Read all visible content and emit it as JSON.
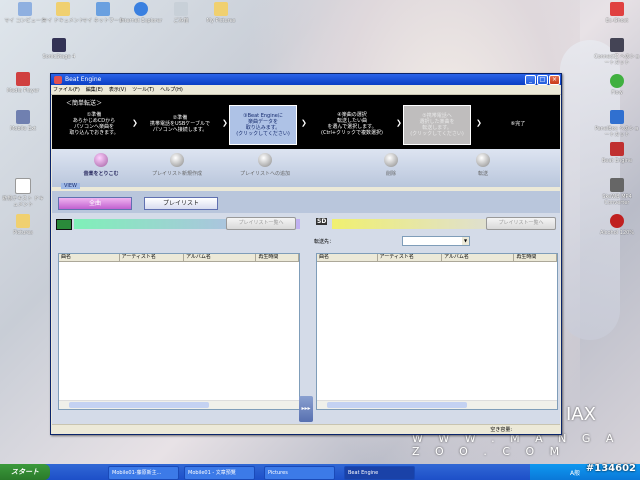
{
  "desktop": {
    "icons_left": [
      {
        "label": "マイ コンピュータ"
      },
      {
        "label": "マイ ドキュメント"
      },
      {
        "label": "マイ ネットワーク"
      },
      {
        "label": "Internet Explorer"
      },
      {
        "label": "ごみ箱"
      },
      {
        "label": "My Pictures"
      }
    ],
    "icons_side_left": [
      {
        "label": "SonicStage 4"
      },
      {
        "label": "Media Player"
      },
      {
        "label": "Mobile Ext"
      },
      {
        "label": "新規テキスト ドキュメント"
      },
      {
        "label": "Pictures"
      }
    ],
    "icons_right": [
      {
        "label": "Ec-Ghost"
      },
      {
        "label": "ConnectZ へのショートカット"
      },
      {
        "label": "Flow"
      },
      {
        "label": "PanelBox へのショートカット"
      },
      {
        "label": "Beat Engine"
      },
      {
        "label": "SkeWB MP4 Converter"
      },
      {
        "label": "Alcohol 120%"
      }
    ],
    "site_text": "W W W . M A N G A Z O O . C O M",
    "brand_text": "IAX",
    "watermark": "#134602"
  },
  "window": {
    "title": "Beat Engine",
    "menu": [
      "ファイル(F)",
      "編集(E)",
      "表示(V)",
      "ツール(T)",
      "ヘルプ(H)"
    ],
    "section_header": "＜簡単転送＞",
    "steps": [
      {
        "text": "①準備\nあらかじめCDから\nパソコンへ楽曲を\n取り込んでおきます。",
        "state": "normal"
      },
      {
        "text": "②準備\n携帯電話をUSBケーブルで\nパソコンへ接続します。",
        "state": "normal"
      },
      {
        "text": "③Beat Engineに\n楽曲データを\n取り込みます。\n(クリックしてください)",
        "state": "active"
      },
      {
        "text": "④楽曲の選択\n転送したい曲\nを選んで選択します。\n(Ctrl+クリックで複数選択)",
        "state": "normal"
      },
      {
        "text": "⑤携帯電話へ\n選択した楽曲を\n転送します。\n(クリックしてください)",
        "state": "disabled"
      },
      {
        "text": "⑥完了",
        "state": "normal"
      }
    ],
    "toolbar": [
      {
        "label": "音楽をとりこむ",
        "enabled": true
      },
      {
        "label": "プレイリスト新規作成",
        "enabled": false
      },
      {
        "label": "プレイリストへの追加",
        "enabled": false
      },
      {
        "label": "削除",
        "enabled": false
      },
      {
        "label": "転送",
        "enabled": false
      }
    ],
    "view_label": "VIEW",
    "view_tabs": [
      {
        "label": "全曲",
        "selected": true
      },
      {
        "label": "プレイリスト",
        "selected": false
      }
    ],
    "left_pane": {
      "playlist_button": "プレイリスト一覧へ",
      "columns": [
        "曲名",
        "アーティスト名",
        "アルバム名",
        "再生時間"
      ]
    },
    "right_pane": {
      "sd_label": "SD",
      "playlist_button": "プレイリスト一覧へ",
      "dest_label": "転送先：",
      "dest_value": "",
      "columns": [
        "曲名",
        "アーティスト名",
        "アルバム名",
        "再生時間"
      ]
    },
    "transfer_arrow": "▸▸▸",
    "status_text": "空き容量:"
  },
  "taskbar": {
    "start_label": "スタート",
    "items": [
      {
        "label": "Mobile01-藤原新主...",
        "active": false
      },
      {
        "label": "Mobile01 - 文章預覽",
        "active": false
      },
      {
        "label": "Pictures",
        "active": false
      },
      {
        "label": "Beat Engine",
        "active": true
      }
    ],
    "tray_text": "A般"
  }
}
